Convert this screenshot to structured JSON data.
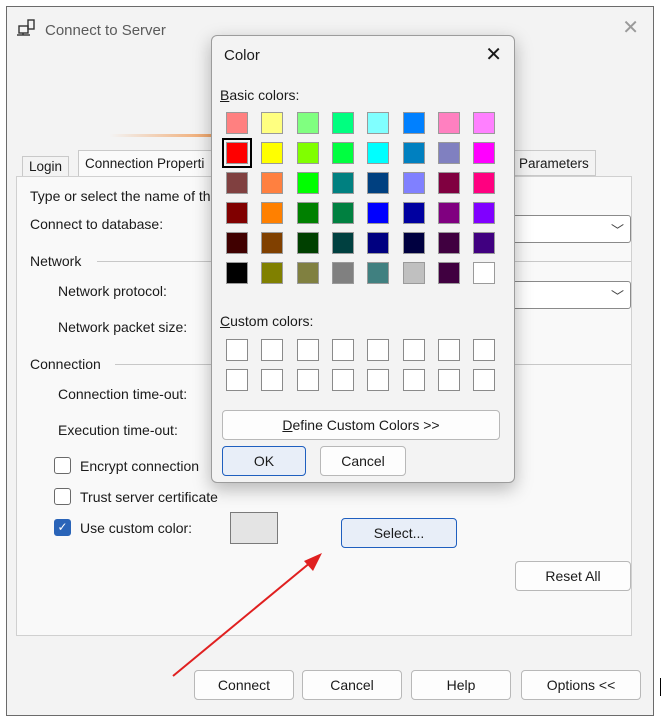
{
  "window": {
    "title": "Connect to Server",
    "close_glyph": "✕"
  },
  "tabs": [
    "Login",
    "Connection Properti",
    "Parameters"
  ],
  "panel": {
    "instruction": "Type or select the name of th",
    "connect_db_label": "Connect to database:",
    "network_group": "Network",
    "network_protocol_label": "Network protocol:",
    "packet_size_label": "Network packet size:",
    "connection_group": "Connection",
    "conn_timeout_label": "Connection time-out:",
    "exec_timeout_label": "Execution time-out:",
    "encrypt_label": "Encrypt connection",
    "trust_label": "Trust server certificate",
    "custom_color_label": "Use custom color:",
    "encrypt_checked": false,
    "trust_checked": false,
    "custom_color_checked": true,
    "custom_color_value": "#e4e4e4",
    "select_button": "Select...",
    "reset_button": "Reset All"
  },
  "footer": {
    "connect": "Connect",
    "cancel": "Cancel",
    "help": "Help",
    "options": "Options <<"
  },
  "color_dialog": {
    "title": "Color",
    "close_glyph": "✕",
    "basic_label_underlined": "B",
    "basic_label_rest": "asic colors:",
    "custom_label_underlined": "C",
    "custom_label_rest": "ustom colors:",
    "define_button_underlined": "D",
    "define_button_rest": "efine Custom Colors >>",
    "ok_button": "OK",
    "cancel_button": "Cancel",
    "selected_index": 8,
    "basic_colors": [
      "#ff8080",
      "#ffff80",
      "#80ff80",
      "#00ff80",
      "#80ffff",
      "#0080ff",
      "#ff80c0",
      "#ff80ff",
      "#ff0000",
      "#ffff00",
      "#80ff00",
      "#00ff40",
      "#00ffff",
      "#0080c0",
      "#8080c0",
      "#ff00ff",
      "#804040",
      "#ff8040",
      "#00ff00",
      "#008080",
      "#004080",
      "#8080ff",
      "#800040",
      "#ff0080",
      "#800000",
      "#ff8000",
      "#008000",
      "#008040",
      "#0000ff",
      "#0000a0",
      "#800080",
      "#8000ff",
      "#400000",
      "#804000",
      "#004000",
      "#004040",
      "#000080",
      "#000040",
      "#400040",
      "#400080",
      "#000000",
      "#808000",
      "#808040",
      "#808080",
      "#408080",
      "#c0c0c0",
      "#400040",
      "#ffffff"
    ],
    "custom_colors": [
      "#ffffff",
      "#ffffff",
      "#ffffff",
      "#ffffff",
      "#ffffff",
      "#ffffff",
      "#ffffff",
      "#ffffff",
      "#ffffff",
      "#ffffff",
      "#ffffff",
      "#ffffff",
      "#ffffff",
      "#ffffff",
      "#ffffff",
      "#ffffff"
    ]
  },
  "annotation": {
    "arrow_color": "#e02020"
  }
}
